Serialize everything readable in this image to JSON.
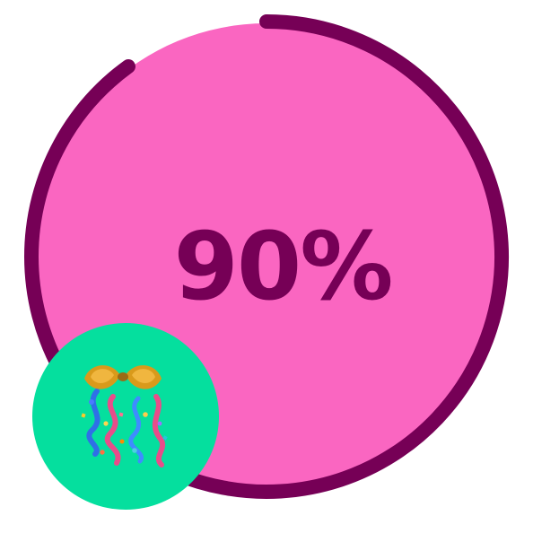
{
  "progress": {
    "percent_label": "90%",
    "percent": 90
  },
  "badge": {
    "icon": "confetti-ball-icon"
  },
  "colors": {
    "pie_fill": "#fa66c1",
    "ring_stroke": "#760056",
    "badge_fill": "#05df9e",
    "text": "#760056"
  }
}
